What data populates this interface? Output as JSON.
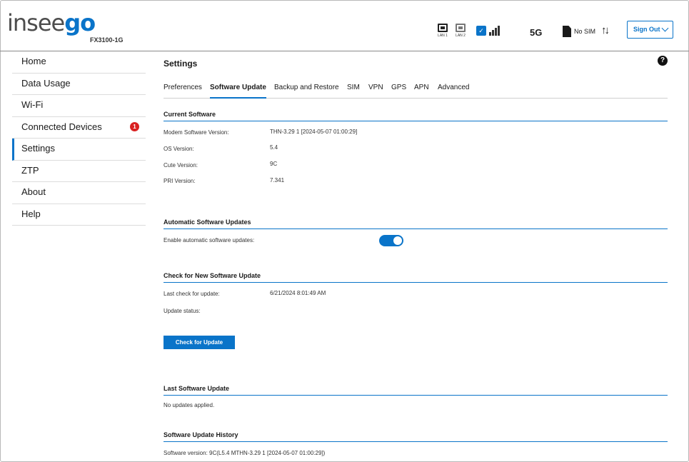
{
  "header": {
    "logo_part1": "insee",
    "logo_part2": "go",
    "model": "FX3100-1G",
    "lan1": "LAN 1",
    "lan2": "LAN 2",
    "network": "5G",
    "sim_status": "No SIM",
    "sign_out": "Sign Out"
  },
  "sidebar": {
    "items": [
      {
        "label": "Home"
      },
      {
        "label": "Data Usage"
      },
      {
        "label": "Wi-Fi"
      },
      {
        "label": "Connected Devices",
        "badge": "1"
      },
      {
        "label": "Settings"
      },
      {
        "label": "ZTP"
      },
      {
        "label": "About"
      },
      {
        "label": "Help"
      }
    ]
  },
  "main": {
    "title": "Settings",
    "help": "?",
    "tabs": [
      {
        "label": "Preferences"
      },
      {
        "label": "Software Update"
      },
      {
        "label": "Backup and Restore"
      },
      {
        "label": "SIM"
      },
      {
        "label": "VPN"
      },
      {
        "label": "GPS"
      },
      {
        "label": "APN"
      },
      {
        "label": "Advanced"
      }
    ],
    "current_software": {
      "title": "Current Software",
      "rows": [
        {
          "label": "Modem Software Version:",
          "value": "THN-3.29 1 [2024-05-07 01:00:29]"
        },
        {
          "label": "OS Version:",
          "value": "5.4"
        },
        {
          "label": "Cute Version:",
          "value": "9C"
        },
        {
          "label": "PRI Version:",
          "value": "7.341"
        }
      ]
    },
    "automatic_updates": {
      "title": "Automatic Software Updates",
      "label": "Enable automatic software updates:",
      "enabled": true
    },
    "check_update": {
      "title": "Check for New Software Update",
      "last_check_label": "Last check for update:",
      "last_check_value": "6/21/2024 8:01:49 AM",
      "status_label": "Update status:",
      "button": "Check for Update"
    },
    "last_update": {
      "title": "Last Software Update",
      "text": "No updates applied."
    },
    "history": {
      "title": "Software Update History",
      "text": "Software version:  9C(L5.4 MTHN-3.29 1 [2024-05-07 01:00:29])"
    }
  },
  "colors": {
    "accent": "#0a74c9",
    "badge": "#d92121"
  },
  "icons": [
    "lan-port-icon",
    "signal-strength-icon",
    "no-sim-icon",
    "data-arrows-icon",
    "chevron-down-icon",
    "help-icon"
  ]
}
